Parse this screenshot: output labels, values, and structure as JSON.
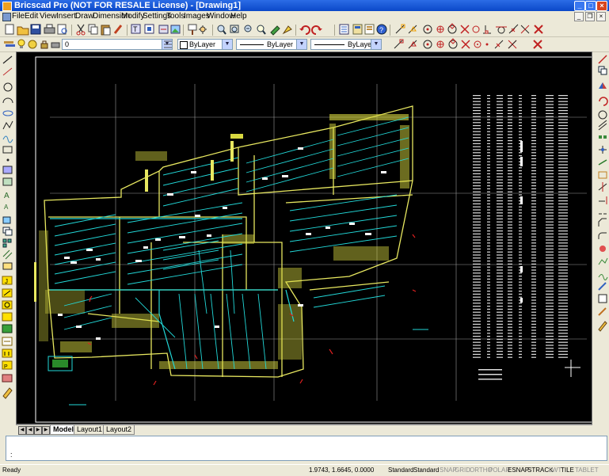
{
  "window": {
    "title": "Bricscad Pro (NOT FOR RESALE License) - [Drawing1]"
  },
  "menu": [
    "File",
    "Edit",
    "View",
    "Insert",
    "Draw",
    "Dimension",
    "Modify",
    "Settings",
    "Tools",
    "Images",
    "Window",
    "Help"
  ],
  "properties_bar": {
    "layer_value": "0",
    "color_value": "ByLayer",
    "linetype_value": "ByLayer",
    "lineweight_value": "ByLayer"
  },
  "icons": [
    "new-icon",
    "open-icon",
    "save-icon",
    "print-icon",
    "cut-icon",
    "copy-icon",
    "paste-icon",
    "undo-icon",
    "redo-icon",
    "zoom-icon",
    "pan-icon",
    "snap-icon",
    "line-icon",
    "circle-icon",
    "arc-icon",
    "polyline-icon",
    "rectangle-icon",
    "hatch-icon",
    "text-icon",
    "move-icon",
    "rotate-icon",
    "mirror-icon",
    "offset-icon",
    "trim-icon",
    "layer-icon",
    "lightbulb-icon"
  ],
  "layout_tabs": {
    "model": "Model",
    "layout1": "Layout1",
    "layout2": "Layout2"
  },
  "command_line": {
    "prompt": ":"
  },
  "status": {
    "ready": "Ready",
    "coords": "1.9743, 1.6645, 0.0000",
    "textstyle": "Standard",
    "dimstyle": "Standard",
    "toggles": [
      {
        "label": "SNAP",
        "on": false
      },
      {
        "label": "GRID",
        "on": false
      },
      {
        "label": "ORTHO",
        "on": false
      },
      {
        "label": "POLAR",
        "on": false
      },
      {
        "label": "ESNAP",
        "on": true
      },
      {
        "label": "STRACK",
        "on": true
      },
      {
        "label": "LWT",
        "on": false
      },
      {
        "label": "TILE",
        "on": true
      },
      {
        "label": "TABLET",
        "on": false
      }
    ]
  },
  "colors": {
    "title_blue": "#0a48c8",
    "drawing_bg": "#000000",
    "wall_yellow": "#e8e860",
    "beam_cyan": "#22d8d8",
    "grid_white": "#ffffff",
    "marker_red": "#e02020"
  }
}
